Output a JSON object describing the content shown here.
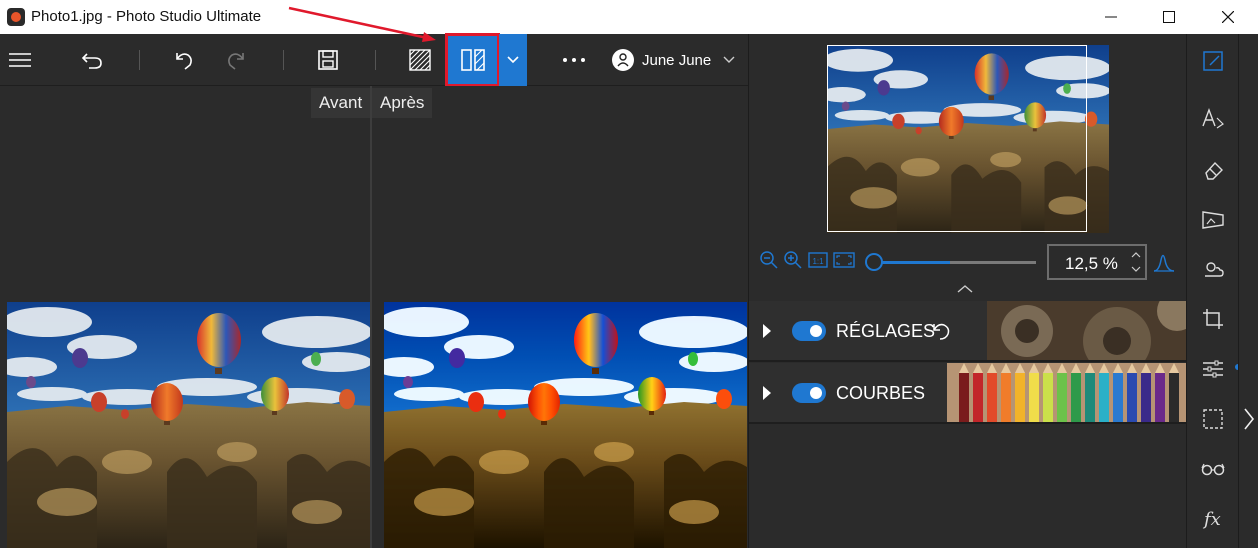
{
  "window": {
    "title": "Photo1.jpg - Photo Studio Ultimate",
    "min_icon": "minimize-icon",
    "max_icon": "maximize-icon",
    "close_icon": "close-icon"
  },
  "toolbar": {
    "menu_icon": "hamburger-menu-icon",
    "back_icon": "back-arrow-icon",
    "undo_icon": "undo-icon",
    "redo_icon": "redo-icon",
    "save_icon": "save-icon",
    "texture_icon": "hatched-square-icon",
    "compare_icon": "compare-split-icon",
    "compare_dropdown_icon": "chevron-down-icon",
    "more_icon": "more-dots-icon",
    "user_name": "June June",
    "user_icon": "user-avatar-icon",
    "user_dropdown_icon": "chevron-down-icon",
    "accent_color": "#1f78d1",
    "highlight_color": "#e0192c"
  },
  "viewer": {
    "before_label": "Avant",
    "after_label": "Après"
  },
  "navigator": {
    "zoom_value": "12,5 %",
    "zoom_level_fraction": 0.47,
    "zoom_out_icon": "zoom-out-icon",
    "zoom_in_icon": "zoom-in-icon",
    "actual_size_icon": "actual-size-icon",
    "fit_icon": "fit-screen-icon",
    "histogram_icon": "histogram-icon",
    "collapse_icon": "chevron-up-icon"
  },
  "sections": [
    {
      "label": "RÉGLAGES",
      "enabled": true,
      "reset_icon": "reset-icon"
    },
    {
      "label": "COURBES",
      "enabled": true
    }
  ],
  "right_tools": [
    "edit-icon",
    "text-effects-icon",
    "eraser-icon",
    "perspective-icon",
    "weather-icon",
    "crop-icon",
    "adjustments-sliders-icon",
    "selection-icon",
    "glasses-icon",
    "fx-icon"
  ],
  "side_strip": {
    "expand_icon": "chevron-right-icon"
  }
}
